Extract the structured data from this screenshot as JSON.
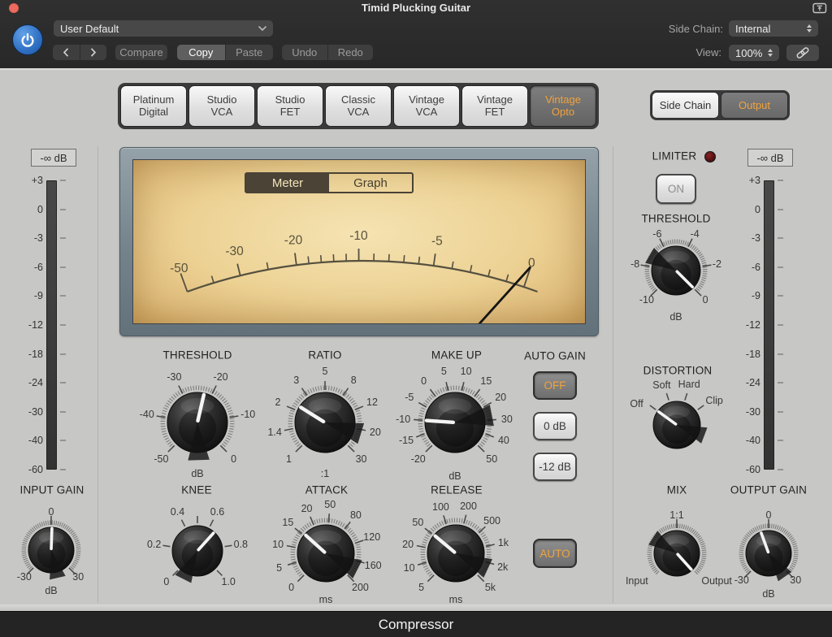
{
  "window": {
    "title": "Timid Plucking Guitar",
    "footer": "Compressor"
  },
  "header": {
    "preset_value": "User Default",
    "compare": "Compare",
    "copy": "Copy",
    "paste": "Paste",
    "undo": "Undo",
    "redo": "Redo",
    "side_chain_label": "Side Chain:",
    "side_chain_value": "Internal",
    "view_label": "View:",
    "view_value": "100%"
  },
  "icons": [
    "power-icon",
    "close-icon",
    "window-upload-icon",
    "link-icon",
    "chevron-left-icon",
    "chevron-right-icon",
    "chevron-down-icon",
    "stepper-icon",
    "led-icon"
  ],
  "models": [
    {
      "lines": [
        "Platinum",
        "Digital"
      ]
    },
    {
      "lines": [
        "Studio",
        "VCA"
      ]
    },
    {
      "lines": [
        "Studio",
        "FET"
      ]
    },
    {
      "lines": [
        "Classic",
        "VCA"
      ]
    },
    {
      "lines": [
        "Vintage",
        "VCA"
      ]
    },
    {
      "lines": [
        "Vintage",
        "FET"
      ]
    },
    {
      "lines": [
        "Vintage",
        "Opto"
      ],
      "selected": true
    }
  ],
  "routing": [
    {
      "label": "Side Chain"
    },
    {
      "label": "Output",
      "selected": true
    }
  ],
  "vu": {
    "tabs": [
      {
        "label": "Meter",
        "selected": true
      },
      {
        "label": "Graph"
      }
    ],
    "labels": [
      {
        "text": "-50",
        "t": 0.0
      },
      {
        "text": "-30",
        "t": 0.155
      },
      {
        "text": "-20",
        "t": 0.315
      },
      {
        "text": "-10",
        "t": 0.49
      },
      {
        "text": "-5",
        "t": 0.7
      },
      {
        "text": "0",
        "t": 0.96
      }
    ],
    "minor_t": [
      0.078,
      0.235,
      0.35,
      0.385,
      0.42,
      0.455,
      0.532,
      0.574,
      0.616,
      0.658,
      0.752,
      0.804,
      0.856,
      0.908
    ],
    "needle_t": 0.96
  },
  "meters": {
    "left_peak": "-∞ dB",
    "right_peak": "-∞ dB",
    "scale": [
      "+3",
      "0",
      "-3",
      "-6",
      "-9",
      "-12",
      "-18",
      "-24",
      "-30",
      "-40",
      "-60"
    ]
  },
  "auto_gain": {
    "title": "AUTO GAIN",
    "options": [
      {
        "label": "OFF",
        "selected": true
      },
      {
        "label": "0 dB"
      },
      {
        "label": "-12 dB"
      }
    ]
  },
  "auto_release": {
    "label": "AUTO",
    "selected": true
  },
  "limiter": {
    "title": "LIMITER",
    "on": "ON"
  },
  "knobs": [
    {
      "id": "threshold",
      "title": "THRESHOLD",
      "pointer": 13,
      "ticks": "dense",
      "labels": [
        {
          "text": "-50",
          "a": -135
        },
        {
          "text": "-40",
          "a": -81
        },
        {
          "text": "-30",
          "a": -27
        },
        {
          "text": "-20",
          "a": 27
        },
        {
          "text": "-10",
          "a": 81
        },
        {
          "text": "0",
          "a": 135
        },
        {
          "text": "dB",
          "a": 180,
          "r": 63,
          "tick": false,
          "sub": true
        }
      ]
    },
    {
      "id": "ratio",
      "title": "RATIO",
      "pointer": -58,
      "ticks": "dense",
      "labels": [
        {
          "text": "1",
          "a": -135
        },
        {
          "text": "1.4",
          "a": -101
        },
        {
          "text": "2",
          "a": -67
        },
        {
          "text": "3",
          "a": -34
        },
        {
          "text": "5",
          "a": 0
        },
        {
          "text": "8",
          "a": 34
        },
        {
          "text": "12",
          "a": 67
        },
        {
          "text": "20",
          "a": 101
        },
        {
          "text": "30",
          "a": 135
        },
        {
          "text": ":1",
          "a": 180,
          "r": 63,
          "tick": false,
          "sub": true
        }
      ]
    },
    {
      "id": "makeup",
      "title": "MAKE UP",
      "pointer": -86,
      "ticks": "dense",
      "labels": [
        {
          "text": "-20",
          "a": -135
        },
        {
          "text": "-15",
          "a": -110.5
        },
        {
          "text": "-10",
          "a": -86
        },
        {
          "text": "-5",
          "a": -61.4
        },
        {
          "text": "0",
          "a": -36.8
        },
        {
          "text": "5",
          "a": -12.3
        },
        {
          "text": "10",
          "a": 12.3
        },
        {
          "text": "15",
          "a": 36.8
        },
        {
          "text": "20",
          "a": 61.4
        },
        {
          "text": "30",
          "a": 86
        },
        {
          "text": "40",
          "a": 110.5
        },
        {
          "text": "50",
          "a": 135
        },
        {
          "text": "dB",
          "a": 180,
          "r": 66,
          "tick": false,
          "sub": true
        }
      ]
    },
    {
      "id": "knee",
      "title": "KNEE",
      "pointer": 42,
      "ticks": "sparse",
      "tick_angles": [
        -135,
        -81,
        -27,
        0,
        27,
        81,
        135
      ],
      "labels": [
        {
          "text": "0",
          "a": -135
        },
        {
          "text": "0.2",
          "a": -81
        },
        {
          "text": "0.4",
          "a": -27
        },
        {
          "text": "0.6",
          "a": 27
        },
        {
          "text": "0.8",
          "a": 81
        },
        {
          "text": "1.0",
          "a": 135
        }
      ]
    },
    {
      "id": "attack",
      "title": "ATTACK",
      "pointer": -48,
      "ticks": "dense",
      "labels": [
        {
          "text": "0",
          "a": -135
        },
        {
          "text": "5",
          "a": -107
        },
        {
          "text": "10",
          "a": -79
        },
        {
          "text": "15",
          "a": -51
        },
        {
          "text": "20",
          "a": -23
        },
        {
          "text": "50",
          "a": 5
        },
        {
          "text": "80",
          "a": 38
        },
        {
          "text": "120",
          "a": 71
        },
        {
          "text": "160",
          "a": 104
        },
        {
          "text": "200",
          "a": 135
        },
        {
          "text": "ms",
          "a": 180,
          "r": 57,
          "tick": false,
          "sub": true
        }
      ]
    },
    {
      "id": "release",
      "title": "RELEASE",
      "pointer": -50,
      "ticks": "dense",
      "labels": [
        {
          "text": "5",
          "a": -135
        },
        {
          "text": "10",
          "a": -107
        },
        {
          "text": "20",
          "a": -79
        },
        {
          "text": "50",
          "a": -51
        },
        {
          "text": "100",
          "a": -18
        },
        {
          "text": "200",
          "a": 15
        },
        {
          "text": "500",
          "a": 48
        },
        {
          "text": "1k",
          "a": 77
        },
        {
          "text": "2k",
          "a": 106
        },
        {
          "text": "5k",
          "a": 135
        },
        {
          "text": "ms",
          "a": 180,
          "r": 57,
          "tick": false,
          "sub": true
        }
      ]
    },
    {
      "id": "limiter_threshold",
      "title": "THRESHOLD",
      "pointer": 135,
      "ticks": "dense",
      "labels": [
        {
          "text": "-6",
          "a": -27
        },
        {
          "text": "-4",
          "a": 27
        },
        {
          "text": "-8",
          "a": -81
        },
        {
          "text": "-2",
          "a": 81
        },
        {
          "text": "-10",
          "a": -135
        },
        {
          "text": "0",
          "a": 135
        },
        {
          "text": "dB",
          "a": 180,
          "r": 57,
          "tick": false,
          "sub": true
        }
      ]
    },
    {
      "id": "distortion",
      "title": "DISTORTION",
      "pointer": -54,
      "ticks": "sparse",
      "tick_angles": [
        -54,
        -18,
        18,
        54
      ],
      "labels": [
        {
          "text": "Off",
          "a": -62,
          "r": 56
        },
        {
          "text": "Soft",
          "a": -21,
          "r": 52
        },
        {
          "text": "Hard",
          "a": 17,
          "r": 52
        },
        {
          "text": "Clip",
          "a": 57,
          "r": 55
        }
      ]
    },
    {
      "id": "mix",
      "title": "MIX",
      "pointer": 138,
      "ticks": "dense",
      "labels": [
        {
          "text": "1:1",
          "a": 0
        },
        {
          "text": "Input",
          "a": -125,
          "r": 60,
          "tick": false,
          "sub": true
        },
        {
          "text": "Output",
          "a": 125,
          "r": 60,
          "tick": false,
          "sub": true
        }
      ]
    },
    {
      "id": "output_gain",
      "title": "OUTPUT GAIN",
      "pointer": -20,
      "ticks": "dense",
      "labels": [
        {
          "text": "0",
          "a": 0
        },
        {
          "text": "-30",
          "a": -135
        },
        {
          "text": "30",
          "a": 135
        },
        {
          "text": "dB",
          "a": 180,
          "r": 50,
          "tick": false,
          "sub": true
        }
      ]
    },
    {
      "id": "input_gain",
      "title": "INPUT GAIN",
      "pointer": 2,
      "ticks": "dense",
      "labels": [
        {
          "text": "0",
          "a": 0
        },
        {
          "text": "-30",
          "a": -135
        },
        {
          "text": "30",
          "a": 135
        },
        {
          "text": "dB",
          "a": 180,
          "r": 50,
          "tick": false,
          "sub": true
        }
      ]
    }
  ],
  "colors": {
    "accent": "#f1a33c",
    "led": "#5c1418",
    "vu_face": "#ecd193",
    "frame": "#73828b"
  }
}
